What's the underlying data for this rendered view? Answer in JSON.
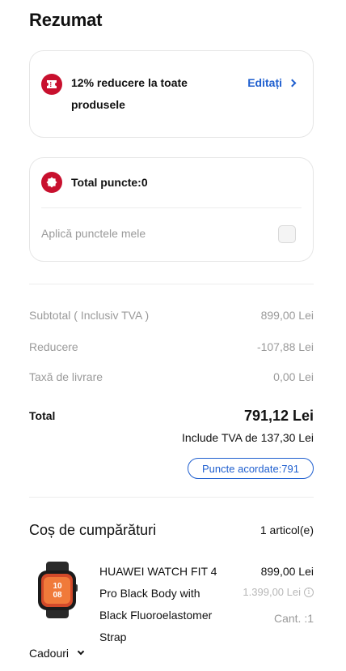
{
  "page": {
    "title": "Rezumat"
  },
  "coupon": {
    "icon": "coupon-ticket-icon",
    "text": "12% reducere la toate produsele",
    "edit_label": "Editați"
  },
  "points": {
    "icon": "points-badge-icon",
    "total_label": "Total puncte:0",
    "apply_label": "Aplică punctele mele",
    "apply_checked": false
  },
  "summary": {
    "subtotal_label": "Subtotal ( Inclusiv TVA )",
    "subtotal_value": "899,00 Lei",
    "discount_label": "Reducere",
    "discount_value": "-107,88 Lei",
    "delivery_label": "Taxă de livrare",
    "delivery_value": "0,00 Lei",
    "total_label": "Total",
    "total_value": "791,12 Lei",
    "vat_note": "Include TVA de 137,30 Lei",
    "points_awarded": "Puncte acordate:791"
  },
  "cart": {
    "title": "Coș de cumpărături",
    "count": "1 articol(e)",
    "items": [
      {
        "name": "HUAWEI WATCH FIT 4 Pro Black Body with Black Fluoroelastomer Strap",
        "price": "899,00 Lei",
        "old_price": "1.399,00 Lei",
        "quantity": "Cant. :1"
      }
    ]
  },
  "gifts": {
    "label": "Cadouri"
  },
  "colors": {
    "accent_red": "#c8102e",
    "link_blue": "#1f5fcf"
  }
}
